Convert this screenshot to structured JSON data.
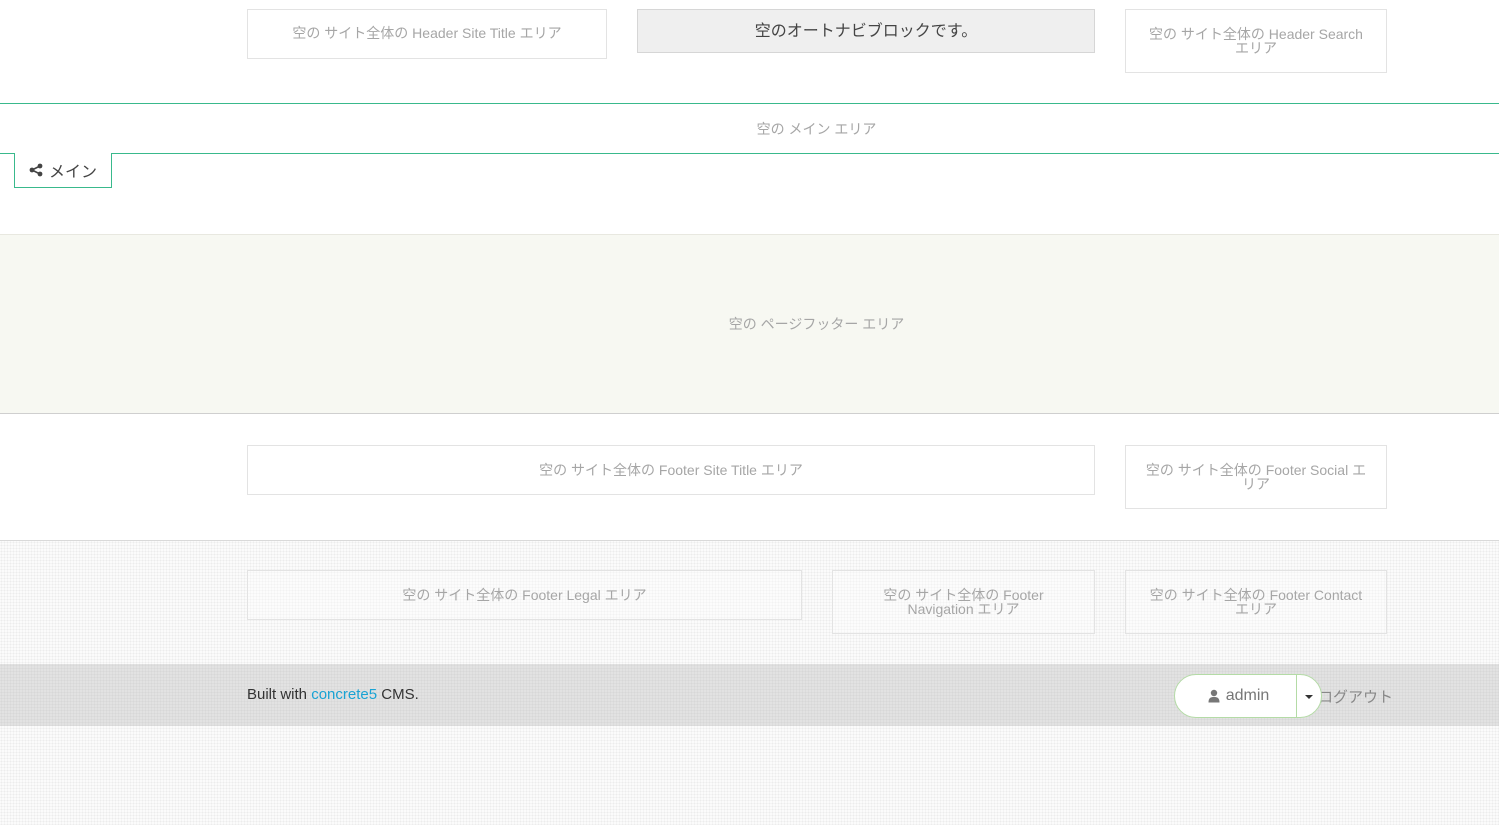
{
  "header": {
    "site_title_area": "空の サイト全体の Header Site Title エリア",
    "autonav": "空のオートナビブロックです。",
    "search_area": "空の サイト全体の Header Search エリア"
  },
  "main": {
    "area": "空の メイン エリア",
    "tab_label": "メイン"
  },
  "page_footer": {
    "area": "空の ページフッター エリア"
  },
  "footer": {
    "site_title_area": "空の サイト全体の Footer Site Title エリア",
    "social_area": "空の サイト全体の Footer Social エリア",
    "legal_area": "空の サイト全体の Footer Legal エリア",
    "navigation_area": "空の サイト全体の Footer Navigation エリア",
    "contact_area": "空の サイト全体の Footer Contact エリア"
  },
  "bottom_bar": {
    "built_prefix": "Built with",
    "built_link": "concrete5",
    "built_suffix": "CMS.",
    "user": "admin",
    "logout": "ログアウト"
  },
  "colors": {
    "accent_green": "#39b98c",
    "link_blue": "#19a3d4",
    "footer_band": "#f7f8f2"
  },
  "icons": {
    "main_tab": "share-icon",
    "admin": "user-icon",
    "dropdown": "caret-down-icon"
  }
}
